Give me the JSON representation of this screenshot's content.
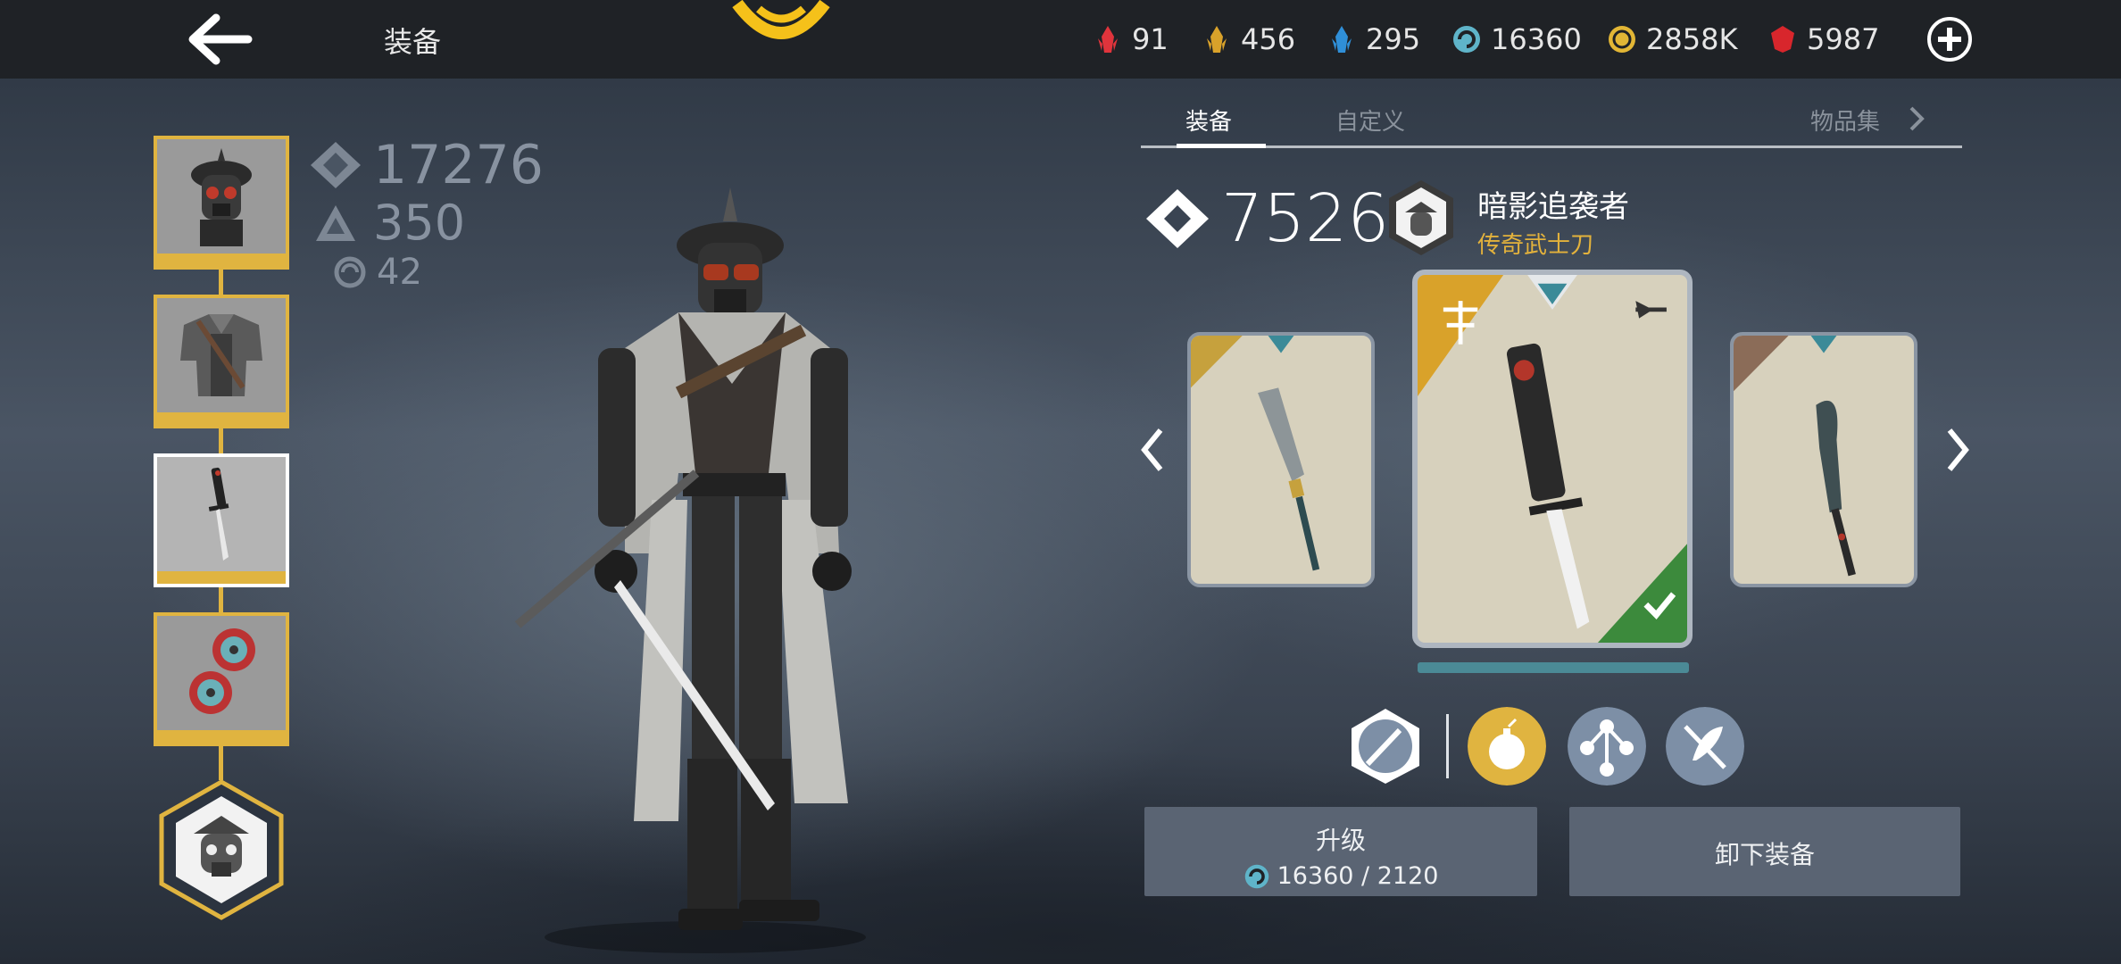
{
  "header": {
    "title": "装备",
    "resources": [
      {
        "name": "red-gem",
        "value": "91",
        "color": "#e0343c"
      },
      {
        "name": "gold-gem",
        "value": "456",
        "color": "#d9a22a"
      },
      {
        "name": "blue-gem",
        "value": "295",
        "color": "#2f8fd8"
      },
      {
        "name": "shadow-energy",
        "value": "16360",
        "color": "#5fb4c9"
      },
      {
        "name": "coins",
        "value": "2858K",
        "color": "#e2b635"
      },
      {
        "name": "ruby",
        "value": "5987",
        "color": "#d8262c"
      }
    ]
  },
  "tabs": [
    {
      "label": "装备",
      "active": true
    },
    {
      "label": "自定义",
      "active": false
    },
    {
      "label": "物品集",
      "active": false
    }
  ],
  "stats": {
    "power": "17276",
    "defense": "350",
    "shadow": "42"
  },
  "item": {
    "score": "7526",
    "name": "暗影追袭者",
    "type": "传奇武士刀"
  },
  "equipment_slots": [
    "helmet",
    "armor",
    "weapon",
    "ranged"
  ],
  "selected_slot": 2,
  "carousel": {
    "selected_progress": 1.0
  },
  "perks": [
    "weapon-enchant-icon",
    "bomb-icon",
    "skill-tree-icon",
    "feather-crossed-icon"
  ],
  "buttons": {
    "upgrade_label": "升级",
    "upgrade_cost": "16360 / 2120",
    "unequip_label": "卸下装备"
  },
  "colors": {
    "accent_gold": "#e0b440",
    "item_type": "#e3b23c",
    "topbar": "#1f2226"
  }
}
